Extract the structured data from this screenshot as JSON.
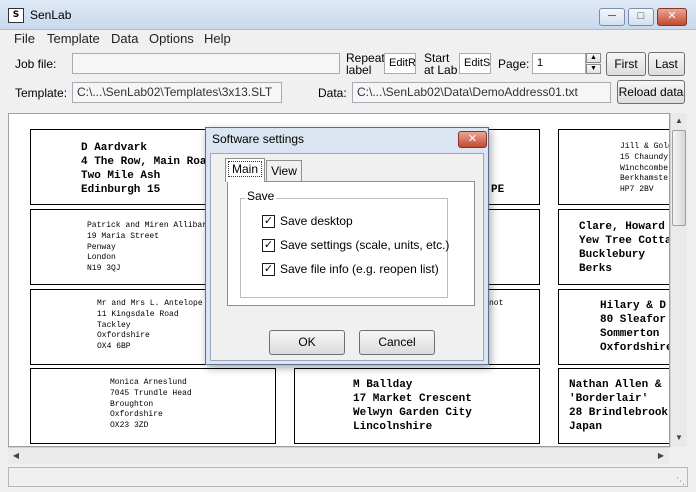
{
  "window": {
    "title": "SenLab",
    "app_icon": "senlab-app-icon",
    "minimize_icon": "minimize-icon",
    "maximize_icon": "maximize-icon",
    "close_icon": "close-icon"
  },
  "menu": [
    "File",
    "Template",
    "Data",
    "Options",
    "Help"
  ],
  "toolbar": {
    "job_file_label": "Job file:",
    "job_file_value": "",
    "repeat_label_line1": "Repeat",
    "repeat_label_line2": "label",
    "repeat_value": "EditR",
    "start_label_line1": "Start",
    "start_label_line2": "at Lab",
    "start_value": "EditSt",
    "page_label": "Page:",
    "page_value": "1",
    "first_button": "First",
    "last_button": "Last",
    "template_label": "Template:",
    "template_value": "C:\\...\\SenLab02\\Templates\\3x13.SLT",
    "data_label": "Data:",
    "data_value": "C:\\...\\SenLab02\\Data\\DemoAddress01.txt",
    "reload_button": "Reload data"
  },
  "labels": [
    [
      "D Aardvark",
      "4 The Row, Main Road",
      "Two Mile Ash",
      "Edinburgh 15"
    ],
    [
      "",
      "",
      "",
      "PE"
    ],
    [
      "Jill & Gold",
      "15 Chaundy",
      "Winchcombe",
      "Berkhamste",
      "HP7 2BV"
    ],
    [
      "Patrick and Miren Allibar",
      "19 Maria Street",
      "Penway",
      "London",
      "N19 3QJ"
    ],
    [],
    [
      "Clare, Howard",
      "Yew Tree Cotta",
      "Bucklebury",
      "Berks"
    ],
    [
      "Mr and Mrs L. Antelope",
      "11 Kingsdale Road",
      "Tackley",
      "Oxfordshire",
      "OX4 6BP"
    ],
    [
      "not"
    ],
    [
      "Hilary & D",
      "80 Sleafor",
      "Sommerton",
      "Oxfordshire"
    ],
    [
      "Monica Arneslund",
      "7045 Trundle Head",
      "Broughton",
      "Oxfordshire",
      "OX23 3ZD"
    ],
    [
      "M Ballday",
      "17 Market Crescent",
      "Welwyn Garden City",
      "Lincolnshire"
    ],
    [
      "Nathan Allen &",
      "'Borderlair'",
      "28 Brindlebrook",
      "Japan"
    ]
  ],
  "dialog": {
    "title": "Software settings",
    "tabs": [
      "Main",
      "View"
    ],
    "group_label": "Save",
    "options": [
      {
        "label": "Save desktop",
        "checked": true
      },
      {
        "label": "Save settings (scale, units, etc.)",
        "checked": true
      },
      {
        "label": "Save file info (e.g. reopen list)",
        "checked": true
      }
    ],
    "ok_button": "OK",
    "cancel_button": "Cancel"
  }
}
